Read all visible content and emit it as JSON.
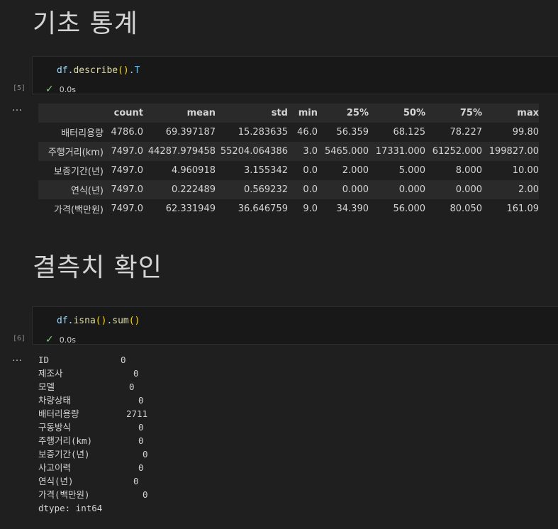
{
  "section1": {
    "title": "기초 통계"
  },
  "cell1": {
    "exec": "[5]",
    "code": {
      "obj": "df",
      "dot1": ".",
      "fn": "describe",
      "parens": "()",
      "dot2": ".",
      "attr": "T"
    },
    "status_time": "0.0s"
  },
  "describe_table": {
    "columns": [
      "",
      "count",
      "mean",
      "std",
      "min",
      "25%",
      "50%",
      "75%",
      "max"
    ],
    "rows": [
      [
        "배터리용량",
        "4786.0",
        "69.397187",
        "15.283635",
        "46.0",
        "56.359",
        "68.125",
        "78.227",
        "99.80"
      ],
      [
        "주행거리(km)",
        "7497.0",
        "44287.979458",
        "55204.064386",
        "3.0",
        "5465.000",
        "17331.000",
        "61252.000",
        "199827.00"
      ],
      [
        "보증기간(년)",
        "7497.0",
        "4.960918",
        "3.155342",
        "0.0",
        "2.000",
        "5.000",
        "8.000",
        "10.00"
      ],
      [
        "연식(년)",
        "7497.0",
        "0.222489",
        "0.569232",
        "0.0",
        "0.000",
        "0.000",
        "0.000",
        "2.00"
      ],
      [
        "가격(백만원)",
        "7497.0",
        "62.331949",
        "36.646759",
        "9.0",
        "34.390",
        "56.000",
        "80.050",
        "161.09"
      ]
    ]
  },
  "section2": {
    "title": "결측치 확인"
  },
  "cell2": {
    "exec": "[6]",
    "code": {
      "obj": "df",
      "dot1": ".",
      "fn1": "isna",
      "p1": "()",
      "dot2": ".",
      "fn2": "sum",
      "p2": "()"
    },
    "status_time": "0.0s"
  },
  "isna_output": {
    "rows": [
      {
        "k": "ID",
        "v": "0"
      },
      {
        "k": "제조사",
        "v": "0"
      },
      {
        "k": "모델",
        "v": "0"
      },
      {
        "k": "차량상태",
        "v": "0"
      },
      {
        "k": "배터리용량",
        "v": "2711"
      },
      {
        "k": "구동방식",
        "v": "0"
      },
      {
        "k": "주행거리(km)",
        "v": "0"
      },
      {
        "k": "보증기간(년)",
        "v": "0"
      },
      {
        "k": "사고이력",
        "v": "0"
      },
      {
        "k": "연식(년)",
        "v": "0"
      },
      {
        "k": "가격(백만원)",
        "v": "0"
      }
    ],
    "dtype": "dtype: int64"
  },
  "more_icon": "…"
}
